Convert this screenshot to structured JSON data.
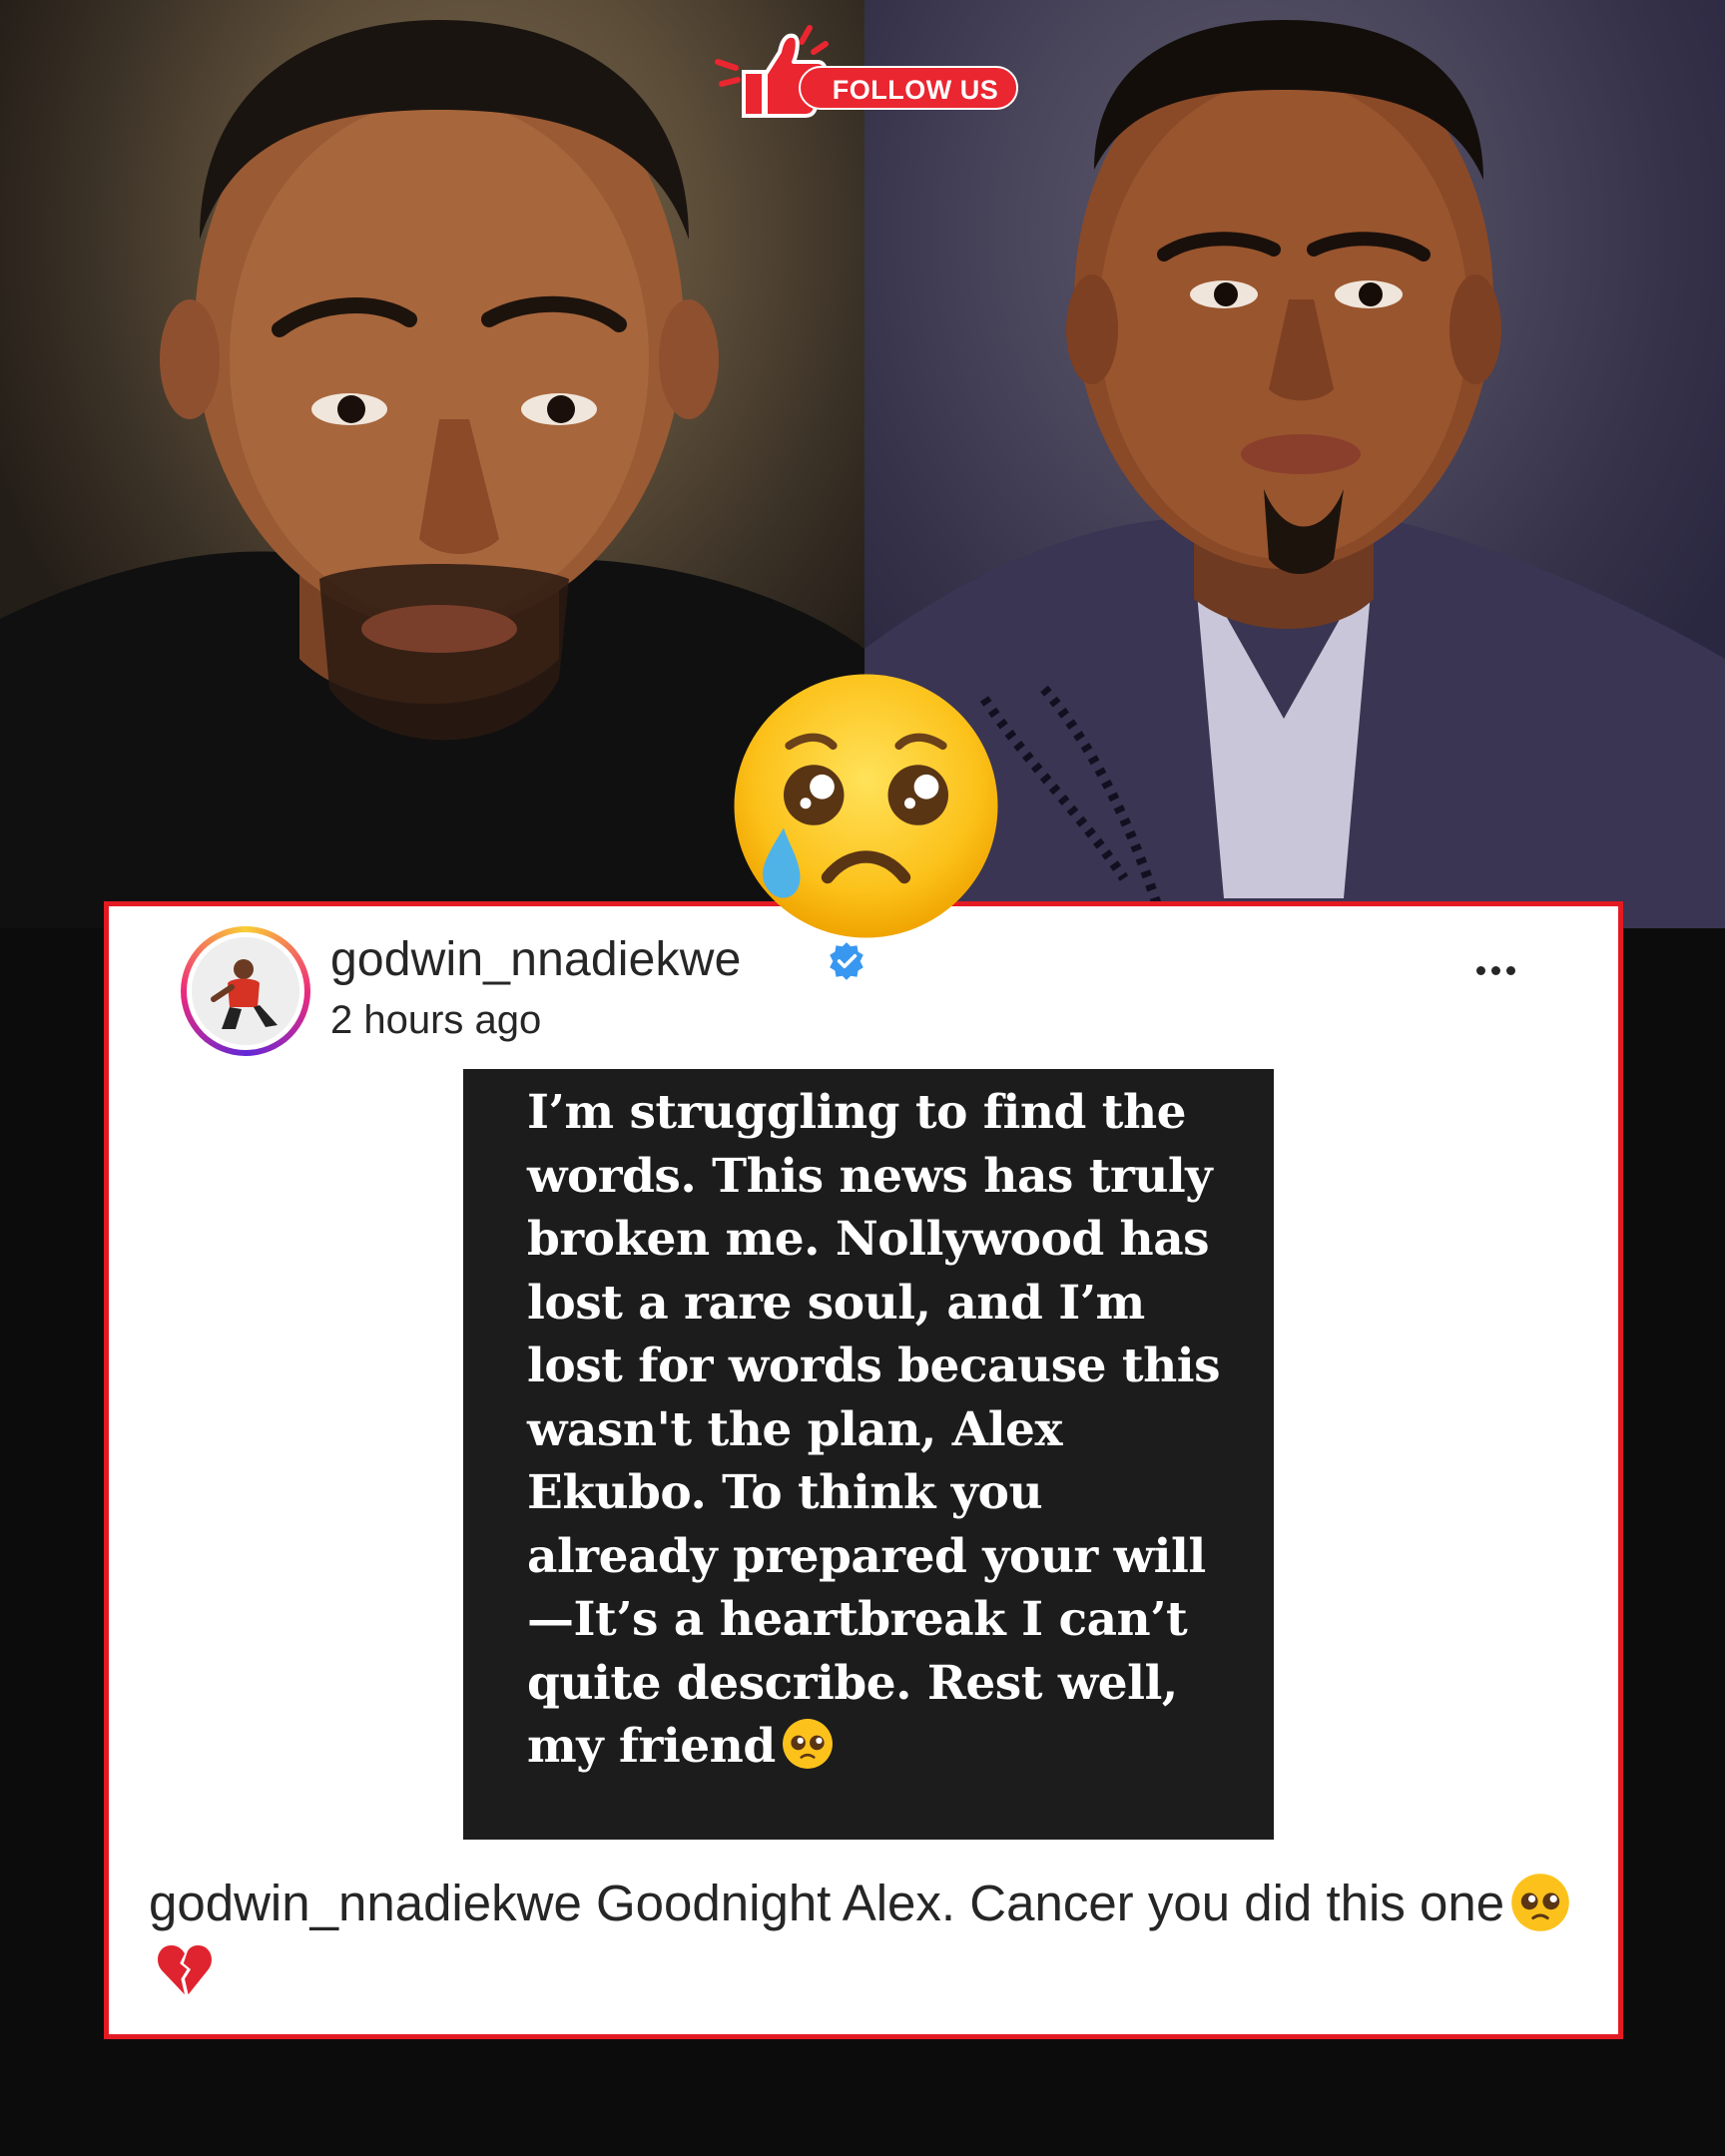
{
  "badge": {
    "label": "FOLLOW US"
  },
  "post": {
    "username": "godwin_nnadiekwe",
    "timestamp": "2 hours ago",
    "quote": "I’m struggling to find the words. This news has truly broken me. Nollywood has lost a rare soul, and I’m lost for words because this wasn't the plan, Alex Ekubo. To think you already prepared your will—It’s a heartbreak I can’t quite describe. Rest well, my friend",
    "caption_user": "godwin_nnadiekwe",
    "caption_text": "Goodnight Alex. Cancer you did this one"
  },
  "icons": {
    "badge": "thumbs-up-icon",
    "reaction": "sad-face-icon",
    "verified": "verified-badge-icon",
    "more": "more-options-icon",
    "quote_end": "pleading-face-icon",
    "caption_end": [
      "pleading-face-icon",
      "broken-heart-icon"
    ]
  },
  "colors": {
    "card_border": "#e41a22",
    "badge_red": "#ea2630",
    "verified_blue": "#3897f0",
    "quote_bg": "#1c1c1c"
  }
}
